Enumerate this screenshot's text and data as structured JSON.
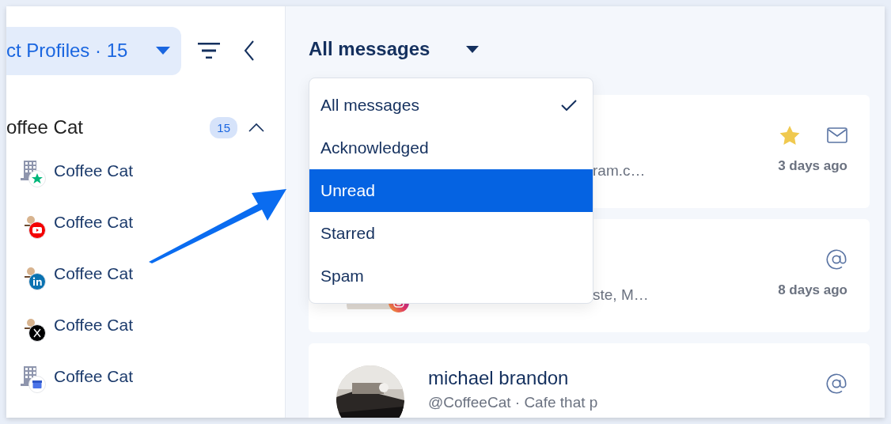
{
  "sidebar": {
    "profile_selector": {
      "label": "ct Profiles · 15"
    },
    "group": {
      "name": "offee Cat",
      "count": "15",
      "expanded": true
    },
    "items": [
      {
        "name": "Coffee Cat",
        "kind": "building",
        "badge": {
          "kind": "trustpilot"
        }
      },
      {
        "name": "Coffee Cat",
        "kind": "logo",
        "badge": {
          "kind": "youtube"
        }
      },
      {
        "name": "Coffee Cat",
        "kind": "logo",
        "badge": {
          "kind": "linkedin"
        }
      },
      {
        "name": "Coffee Cat",
        "kind": "logo",
        "badge": {
          "kind": "x"
        }
      },
      {
        "name": "Coffee Cat",
        "kind": "building",
        "badge": {
          "kind": "store"
        }
      }
    ]
  },
  "main": {
    "filter": {
      "label": "All messages"
    },
    "dropdown": {
      "options": [
        {
          "label": "All messages",
          "selected": true,
          "highlighted": false
        },
        {
          "label": "Acknowledged",
          "selected": false,
          "highlighted": false
        },
        {
          "label": "Unread",
          "selected": false,
          "highlighted": true
        },
        {
          "label": "Starred",
          "selected": false,
          "highlighted": false
        },
        {
          "label": "Spam",
          "selected": false,
          "highlighted": false
        }
      ]
    },
    "messages": [
      {
        "preview": "ram.c…",
        "time": "3 days ago",
        "starred": true,
        "channel": {
          "kind": "mail"
        },
        "avatar": {
          "kind": "hidden"
        }
      },
      {
        "preview": "ste, M…",
        "time": "8 days ago",
        "starred": false,
        "channel": {
          "kind": "mention"
        },
        "avatar": {
          "kind": "instagram"
        }
      },
      {
        "name": "michael brandon",
        "preview": "@CoffeeCat · Cafe that p",
        "starred": false,
        "channel": {
          "kind": "mention"
        }
      }
    ]
  }
}
